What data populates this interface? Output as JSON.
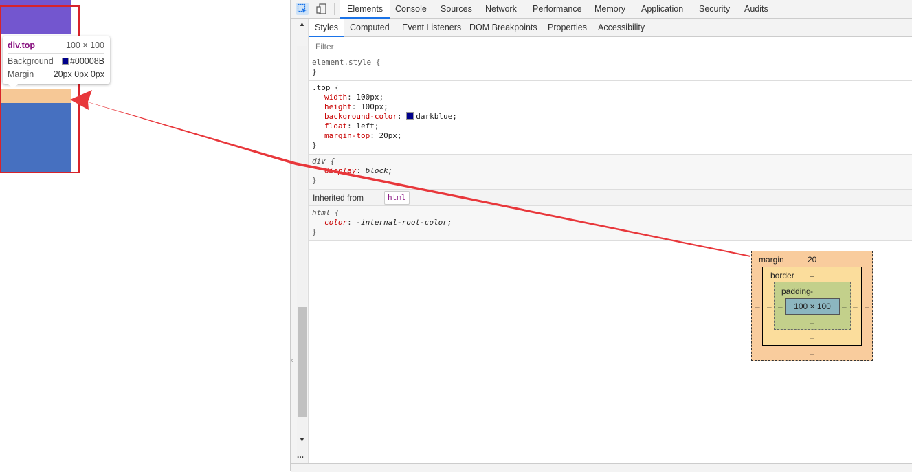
{
  "tooltip": {
    "selector": "div.top",
    "dims": "100 × 100",
    "background_label": "Background",
    "background_value": "#00008B",
    "margin_label": "Margin",
    "margin_value": "20px 0px 0px"
  },
  "devtools": {
    "main_tabs": [
      "Elements",
      "Console",
      "Sources",
      "Network",
      "Performance",
      "Memory",
      "Application",
      "Security",
      "Audits"
    ],
    "selected_main_tab": "Elements",
    "sub_tabs": [
      "Styles",
      "Computed",
      "Event Listeners",
      "DOM Breakpoints",
      "Properties",
      "Accessibility"
    ],
    "selected_sub_tab": "Styles",
    "filter_placeholder": "Filter",
    "rules": {
      "element_style": {
        "selector": "element.style {",
        "close": "}"
      },
      "top": {
        "selector": ".top {",
        "props": [
          {
            "name": "width",
            "value": "100px;"
          },
          {
            "name": "height",
            "value": "100px;"
          },
          {
            "name": "background-color",
            "value": "darkblue;"
          },
          {
            "name": "float",
            "value": "left;"
          },
          {
            "name": "margin-top",
            "value": "20px;"
          }
        ],
        "close": "}"
      },
      "div": {
        "selector": "div {",
        "props": [
          {
            "name": "display",
            "value": "block;"
          }
        ],
        "close": "}"
      },
      "inherited_label": "Inherited from",
      "inherited_tag": "html",
      "html": {
        "selector": "html {",
        "props": [
          {
            "name": "color",
            "value": "-internal-root-color;"
          }
        ],
        "close": "}"
      }
    },
    "box_model": {
      "margin_label": "margin",
      "margin_top": "20",
      "margin_right": "–",
      "margin_bottom": "–",
      "margin_left": "–",
      "border_label": "border",
      "border_top": "–",
      "border_right": "–",
      "border_bottom": "–",
      "border_left": "–",
      "padding_label": "padding",
      "padding_top": "-",
      "padding_right": "–",
      "padding_bottom": "–",
      "padding_left": "–",
      "content": "100 × 100"
    },
    "sidebar_more": "..."
  },
  "colors": {
    "accent": "#1a73e8",
    "highlight_margin": "#f6c896",
    "annotation": "#e8373b"
  }
}
